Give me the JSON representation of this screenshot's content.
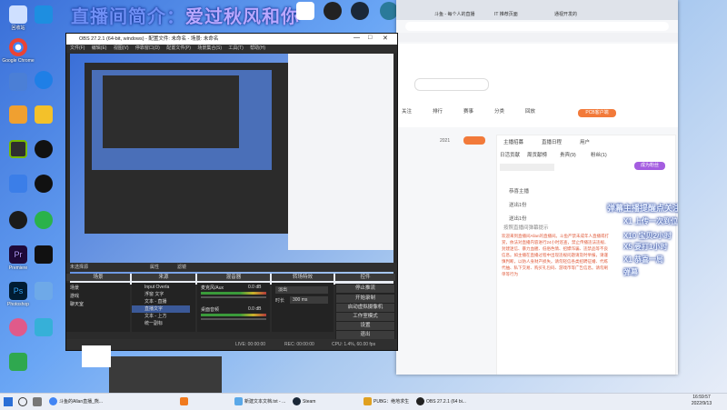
{
  "banner": {
    "left": "直播间简介：",
    "right": "爱过秋风和你"
  },
  "desktop": {
    "icons_left": [
      "",
      "",
      "",
      "",
      "",
      "",
      "",
      "",
      "",
      "",
      "",
      "",
      "",
      "",
      ""
    ],
    "col1": [
      "回收站",
      "Google Chrome",
      "",
      "",
      "",
      "",
      "",
      "",
      "",
      "",
      "Premiere",
      "Photoshop",
      "",
      "",
      ""
    ],
    "col2": [
      "",
      "",
      "",
      "",
      "",
      "",
      "",
      "",
      "",
      "",
      "",
      "",
      "",
      "",
      "",
      ""
    ]
  },
  "obs": {
    "title": "OBS 27.2.1 (64-bit, windows) - 配置文件: 未命名 - 场景: 未命名",
    "menu": [
      "文件(F)",
      "编辑(E)",
      "视图(V)",
      "停靠窗口(D)",
      "配置文件(P)",
      "场景集合(S)",
      "工具(T)",
      "帮助(H)"
    ],
    "scene_label": "未选择源",
    "toolbar": [
      "属性",
      "滤镜"
    ],
    "docks": [
      "场景",
      "来源",
      "混音器",
      "转场特效",
      "控件"
    ],
    "scenes": [
      "场景",
      "游戏",
      "聊天室"
    ],
    "sources": [
      "Input Overla",
      "浮窗 文字",
      "文本 - 直播",
      "直播文字",
      "文本 - 上方",
      "统一副标"
    ],
    "mixer": [
      {
        "name": "麦克风/Aux",
        "value": "0.0 dB"
      },
      {
        "name": "桌面音频",
        "value": "0.0 dB"
      }
    ],
    "transition": {
      "type": "淡出",
      "duration_label": "时长",
      "duration": "300 ms"
    },
    "controls": [
      "停止推流",
      "开始录制",
      "启动虚拟摄像机",
      "工作室模式",
      "设置",
      "退出"
    ],
    "status": {
      "drop": "丢帧 0 (0.0%)",
      "live": "LIVE: 00:00:00",
      "rec": "REC: 00:00:00",
      "cpu": "CPU: 1.4%, 60.00 fps"
    }
  },
  "browser": {
    "tabs": [
      "斗鱼 - 每个人的直播",
      "IT 推荐页面",
      "通视开发的"
    ],
    "nav": [
      "关注",
      "排行",
      "赛事",
      "分类",
      "回放"
    ],
    "room_tabs": [
      "日活贡献",
      "周贡献榜",
      "贵宾(9)",
      "粉丝(1)"
    ],
    "rank_tabs": [
      "主播招募",
      "直播日程",
      "用户",
      "秘信"
    ],
    "fans_label": "成为粉丝",
    "rank_items": [
      "恭喜主播",
      "送出1份",
      "送出1份"
    ],
    "notice_title": "弹幕公告",
    "notice_head": "按照直播间弹幕提示",
    "live_badge": "PCB客户端",
    "follow_count": "2021",
    "notice_text": "欢迎来到直播间Allan的直播间。斗鱼严禁未成年人直播或打赏，依法对直播内容进行24小时巡查，禁止传播违法违规、封建迷信、暴力血腥、低俗色情、招嫖诈骗、违禁品等不良信息。如主播在直播过程中出现违规问题请及时举报，请谨慎判断，以防人身财产损失。请勿轻信各类招聘征婚、代练代抽、私下交易、购买礼包码、游戏币等广告信息。请勿刷单等行为",
    "overlay_lines": [
      "弹幕主播提醒点关注",
      "X1 上传一次到位",
      "X10 宝贝2小时",
      "X5 要打1小时",
      "X1 恭喜一局",
      "弹幕"
    ]
  },
  "taskbar": {
    "items": [
      "斗鱼的Allan直播_熊...",
      "",
      "新建文本文档.txt - ...",
      "Steam",
      "PUBG：绝地求生",
      "OBS 27.2.1 (64 bi..."
    ],
    "time": "16:59:57",
    "date": "2022/9/13"
  },
  "colors": {
    "obs_bg": "#2b2b2b",
    "accent_orange": "#f27a3a",
    "taskbar_bg": "#eaeef6"
  }
}
